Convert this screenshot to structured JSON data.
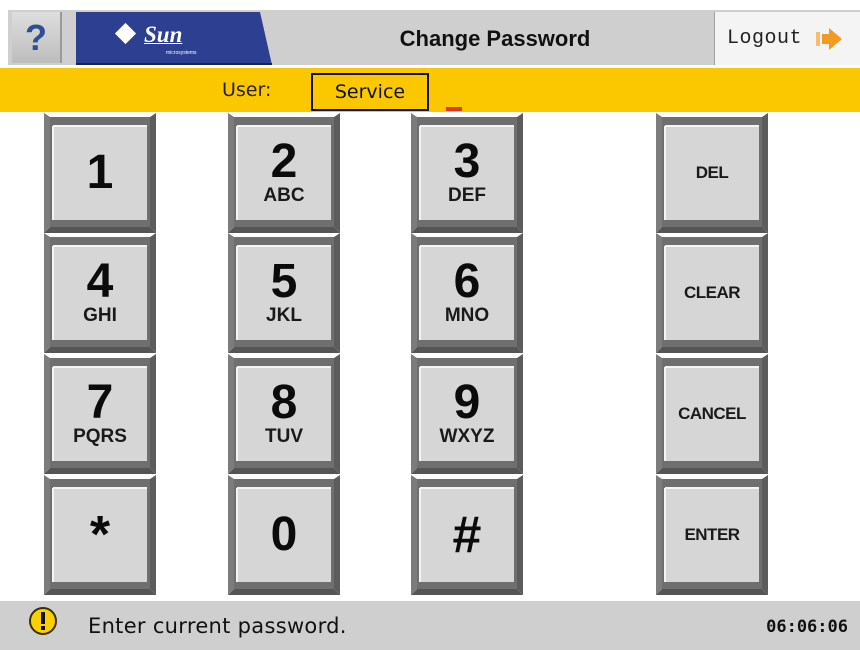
{
  "header": {
    "help_label": "?",
    "logo_text": "Sun",
    "logo_subtext": "microsystems",
    "title": "Change Password",
    "logout_label": "Logout",
    "colors": {
      "logo_blue": "#2c3f90",
      "help_blue": "#2f4e96",
      "logout_arrow": "#f29a22"
    }
  },
  "user_bar": {
    "label": "User:",
    "value": "Service",
    "color": "#fbc800"
  },
  "keypad": {
    "keys": [
      {
        "digit": "1",
        "letters": ""
      },
      {
        "digit": "2",
        "letters": "ABC"
      },
      {
        "digit": "3",
        "letters": "DEF"
      },
      {
        "digit": "4",
        "letters": "GHI"
      },
      {
        "digit": "5",
        "letters": "JKL"
      },
      {
        "digit": "6",
        "letters": "MNO"
      },
      {
        "digit": "7",
        "letters": "PQRS"
      },
      {
        "digit": "8",
        "letters": "TUV"
      },
      {
        "digit": "9",
        "letters": "WXYZ"
      },
      {
        "digit": "*",
        "letters": ""
      },
      {
        "digit": "0",
        "letters": ""
      },
      {
        "digit": "#",
        "letters": ""
      }
    ],
    "functions": {
      "del": "DEL",
      "clear": "CLEAR",
      "cancel": "CANCEL",
      "enter": "ENTER"
    }
  },
  "status_bar": {
    "icon": "warning-icon",
    "message": "Enter current password.",
    "time": "06:06:06"
  }
}
